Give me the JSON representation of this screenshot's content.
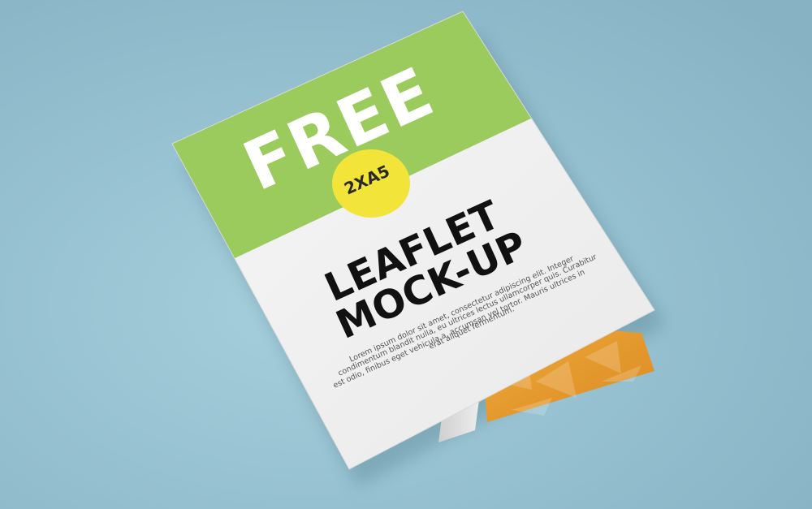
{
  "scene": {
    "background_color": "#8fbccc",
    "background_highlight": "#a3ccd9",
    "brand_green": "#9acb5c",
    "accent_yellow": "#f3e43a",
    "inner_orange": "#e8a23a",
    "paper_white": "#f3f3f3"
  },
  "leaflet": {
    "headline": "FREE",
    "badge": "2XA5",
    "title_line1": "LEAFLET",
    "title_line2": "MOCK-UP",
    "body_lines": [
      "Lorem ipsum dolor sit amet, consectetur adipiscing elit. Integer",
      "condimentum blandit nulla, eu ultrices lectus ullamcorper quis. Curabitur",
      "est odio, finibus eget vehicula a, accumsan vel tortor. Mauris ultrices in",
      "erat aliquet fermentum."
    ]
  }
}
